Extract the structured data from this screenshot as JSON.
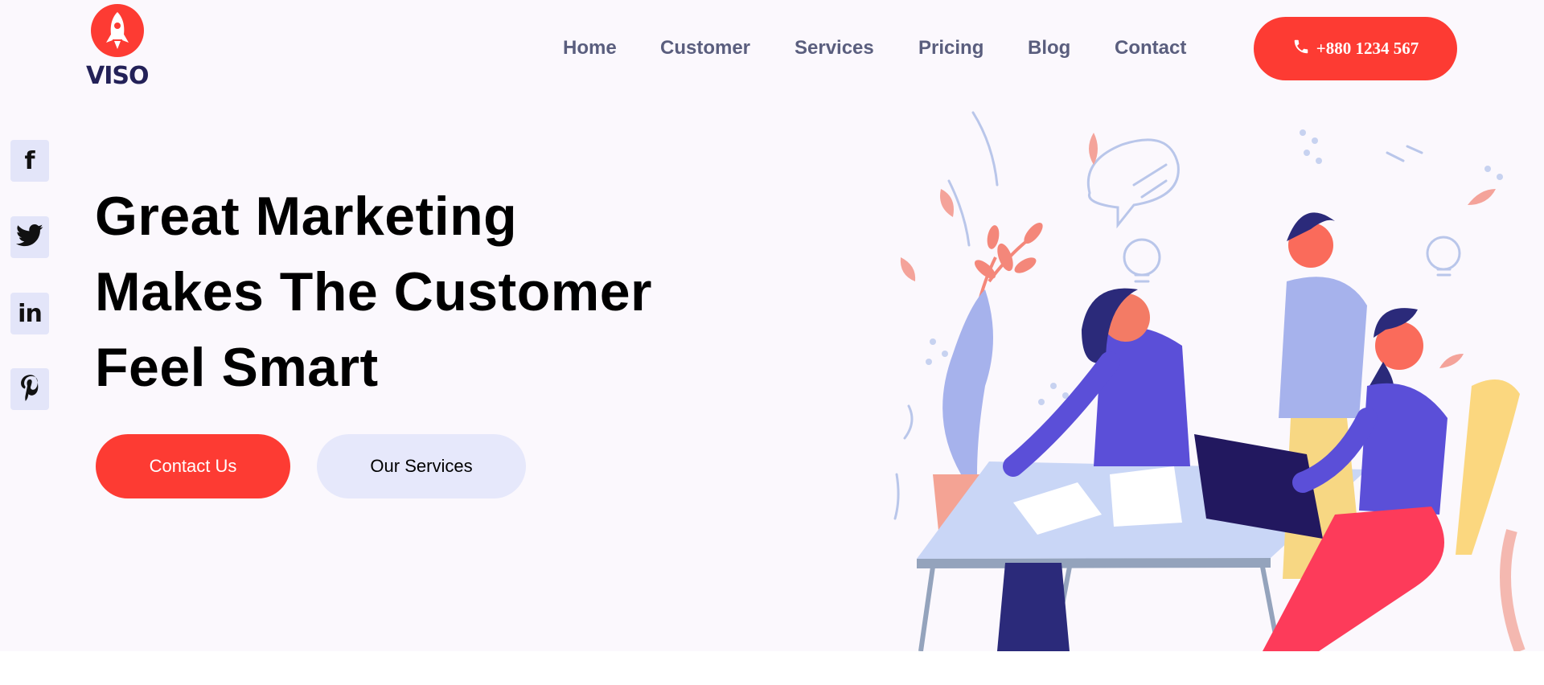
{
  "brand": {
    "name": "VISO",
    "accent": "#fd3b33",
    "dark": "#232158"
  },
  "nav": {
    "items": [
      {
        "label": "Home"
      },
      {
        "label": "Customer"
      },
      {
        "label": "Services"
      },
      {
        "label": "Pricing"
      },
      {
        "label": "Blog"
      },
      {
        "label": "Contact"
      }
    ],
    "phone": {
      "icon": "phone-icon",
      "label": "+880 1234 567"
    }
  },
  "social": [
    {
      "icon": "facebook-icon",
      "glyph": "f"
    },
    {
      "icon": "twitter-icon",
      "glyph": ""
    },
    {
      "icon": "linkedin-icon",
      "glyph": "in"
    },
    {
      "icon": "pinterest-icon",
      "glyph": "p"
    }
  ],
  "hero": {
    "title_lines": [
      "Great Marketing",
      "Makes The Customer",
      "Feel Smart"
    ],
    "primary_button": "Contact Us",
    "secondary_button": "Our Services"
  },
  "illustration": {
    "name": "team-working-illustration"
  }
}
